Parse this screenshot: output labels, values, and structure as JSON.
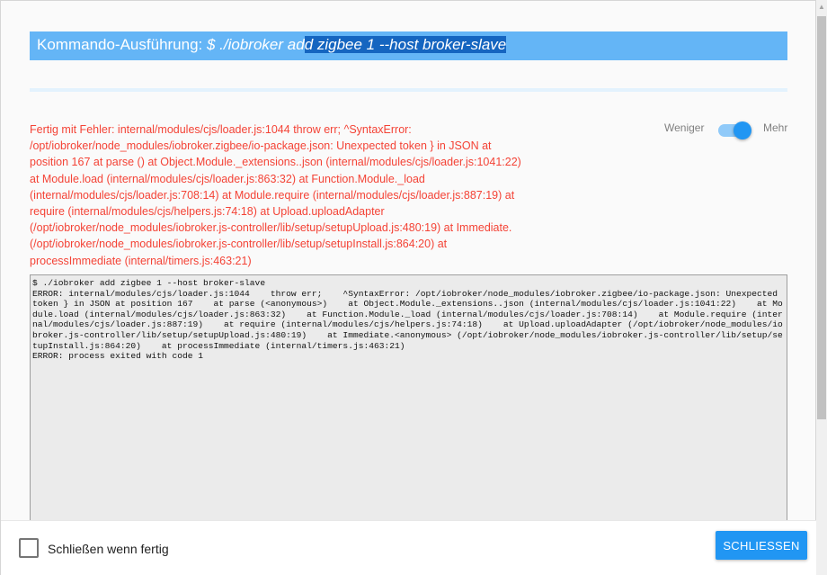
{
  "dialog": {
    "title_prefix": "Kommando-Ausführung: ",
    "title_cmd_plain": "$ ./iobroker ad",
    "title_cmd_selected": "d zigbee 1 --host broker-slave"
  },
  "error_message": "Fertig mit Fehler: internal/modules/cjs/loader.js:1044 throw err; ^SyntaxError: /opt/iobroker/node_modules/iobroker.zigbee/io-package.json: Unexpected token } in JSON at position 167 at parse () at Object.Module._extensions..json (internal/modules/cjs/loader.js:1041:22) at Module.load (internal/modules/cjs/loader.js:863:32) at Function.Module._load (internal/modules/cjs/loader.js:708:14) at Module.require (internal/modules/cjs/loader.js:887:19) at require (internal/modules/cjs/helpers.js:74:18) at Upload.uploadAdapter (/opt/iobroker/node_modules/iobroker.js-controller/lib/setup/setupUpload.js:480:19) at Immediate. (/opt/iobroker/node_modules/iobroker.js-controller/lib/setup/setupInstall.js:864:20) at processImmediate (internal/timers.js:463:21)",
  "toggle": {
    "less_label": "Weniger",
    "more_label": "Mehr",
    "state": "more"
  },
  "console": {
    "lines": [
      "$ ./iobroker add zigbee 1 --host broker-slave",
      "ERROR: internal/modules/cjs/loader.js:1044    throw err;    ^SyntaxError: /opt/iobroker/node_modules/iobroker.zigbee/io-package.json: Unexpected token } in JSON at position 167    at parse (<anonymous>)    at Object.Module._extensions..json (internal/modules/cjs/loader.js:1041:22)    at Module.load (internal/modules/cjs/loader.js:863:32)    at Function.Module._load (internal/modules/cjs/loader.js:708:14)    at Module.require (internal/modules/cjs/loader.js:887:19)    at require (internal/modules/cjs/helpers.js:74:18)    at Upload.uploadAdapter (/opt/iobroker/node_modules/iobroker.js-controller/lib/setup/setupUpload.js:480:19)    at Immediate.<anonymous> (/opt/iobroker/node_modules/iobroker.js-controller/lib/setup/setupInstall.js:864:20)    at processImmediate (internal/timers.js:463:21)",
      "ERROR: process exited with code 1"
    ]
  },
  "footer": {
    "checkbox_label": "Schließen wenn fertig",
    "checkbox_checked": false,
    "close_button_label": "SCHLIESSEN"
  },
  "colors": {
    "accent": "#2196f3",
    "title_bar": "#64b5f6",
    "error_text": "#f44336"
  }
}
